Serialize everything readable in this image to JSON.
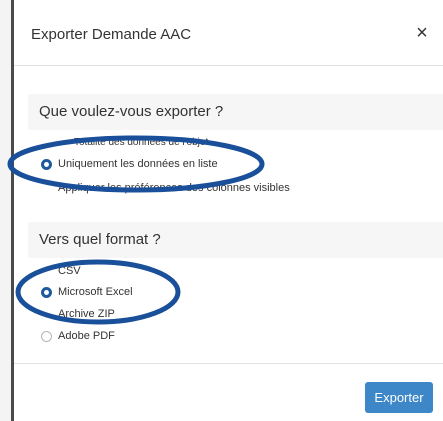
{
  "dialog": {
    "title": "Exporter Demande AAC",
    "close": "×"
  },
  "what_section": {
    "heading": "Que voulez-vous exporter ?",
    "options": [
      {
        "label": "Totalité des données de l'objet",
        "selected": false
      },
      {
        "label": "Uniquement les données en liste",
        "selected": true
      },
      {
        "label": "Appliquer les préférences des colonnes visibles",
        "selected": false
      }
    ]
  },
  "format_section": {
    "heading": "Vers quel format ?",
    "options": [
      {
        "label": "CSV",
        "selected": false
      },
      {
        "label": "Microsoft Excel",
        "selected": true
      },
      {
        "label": "Archive ZIP",
        "selected": false
      },
      {
        "label": "Adobe PDF",
        "selected": false
      }
    ]
  },
  "footer": {
    "export_label": "Exporter"
  },
  "colors": {
    "accent": "#3d87c9",
    "annotation": "#1a4f9a",
    "selected_radio": "#1f5a9c"
  }
}
